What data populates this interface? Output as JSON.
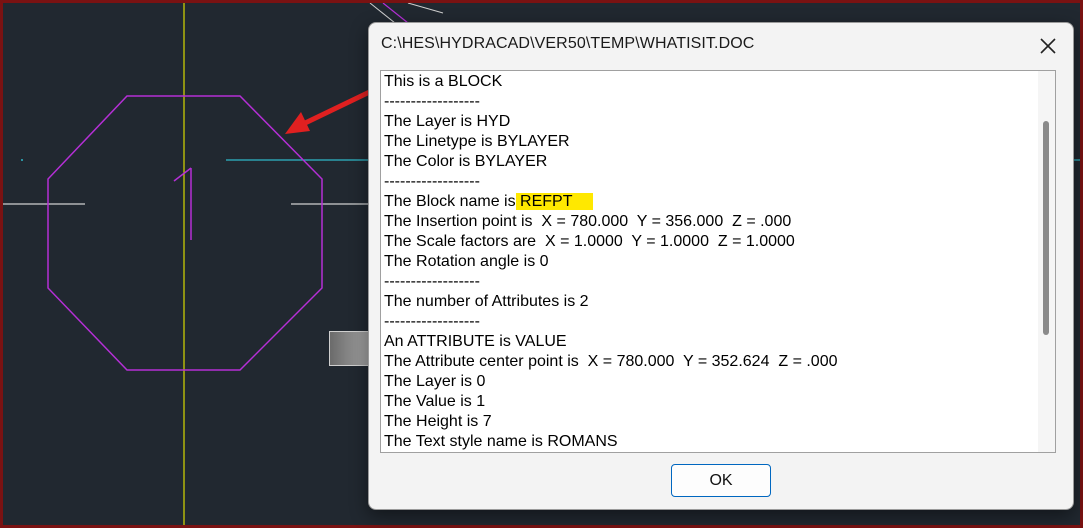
{
  "dialog": {
    "title": "C:\\HES\\HYDRACAD\\VER50\\TEMP\\WHATISIT.DOC",
    "close_icon": "close-icon",
    "lines": [
      "This is a BLOCK",
      "------------------",
      "The Layer is HYD",
      "The Linetype is BYLAYER",
      "The Color is BYLAYER",
      "------------------",
      "The Block name is",
      "The Insertion point is  X = 780.000  Y = 356.000  Z = .000",
      "The Scale factors are  X = 1.0000  Y = 1.0000  Z = 1.0000",
      "The Rotation angle is 0",
      "------------------",
      "The number of Attributes is 2",
      "------------------",
      "An ATTRIBUTE is VALUE",
      "The Attribute center point is  X = 780.000  Y = 352.624  Z = .000",
      "The Layer is 0",
      "The Value is 1",
      "The Height is 7",
      "The Text style name is ROMANS"
    ],
    "block_name_value": " REFPT",
    "highlight_color": "#ffe800",
    "ok_label": "OK"
  },
  "cad": {
    "background": "#212830",
    "octagon_color": "#b52fd6",
    "centerline_color": "#d8d800",
    "cyan_line_color": "#2fb8c8",
    "white_line_color": "#d0d0d0",
    "red_arrow_color": "#e02020",
    "octagon_label": "1"
  }
}
